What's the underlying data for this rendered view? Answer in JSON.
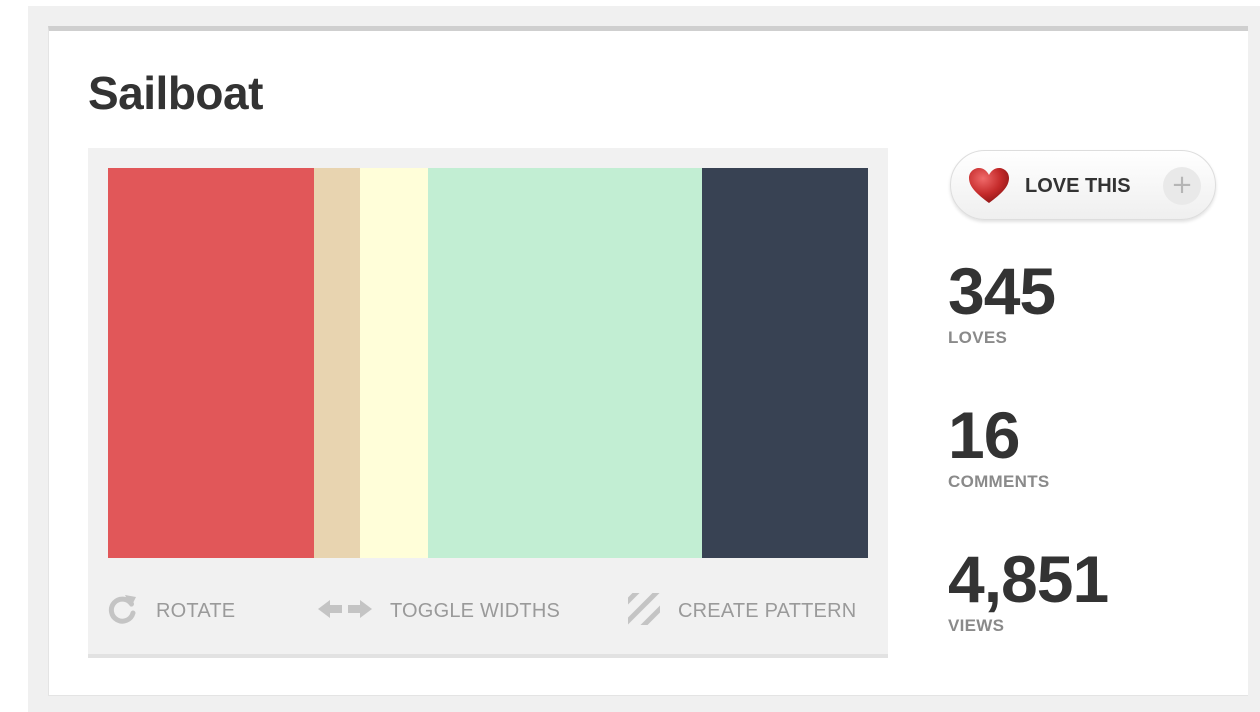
{
  "title": "Sailboat",
  "palette": [
    {
      "hex": "#e15759",
      "share": 0.271
    },
    {
      "hex": "#e8d4b0",
      "share": 0.061
    },
    {
      "hex": "#fffed9",
      "share": 0.089
    },
    {
      "hex": "#c2eed3",
      "share": 0.361
    },
    {
      "hex": "#384253",
      "share": 0.218
    }
  ],
  "tools": {
    "rotate": {
      "label": "ROTATE",
      "icon": "rotate-icon"
    },
    "toggle_widths": {
      "label": "TOGGLE WIDTHS",
      "icon": "double-arrow-icon"
    },
    "create_pattern": {
      "label": "CREATE PATTERN",
      "icon": "stripes-icon"
    }
  },
  "love_button": {
    "label": "LOVE THIS",
    "icon": "heart-icon",
    "plus": "+"
  },
  "stats": {
    "loves": {
      "value": "345",
      "label": "LOVES"
    },
    "comments": {
      "value": "16",
      "label": "COMMENTS"
    },
    "views": {
      "value": "4,851",
      "label": "VIEWS"
    }
  },
  "colors": {
    "icon_gray": "#c4c4c4",
    "heart_red": "#c42a2a"
  }
}
